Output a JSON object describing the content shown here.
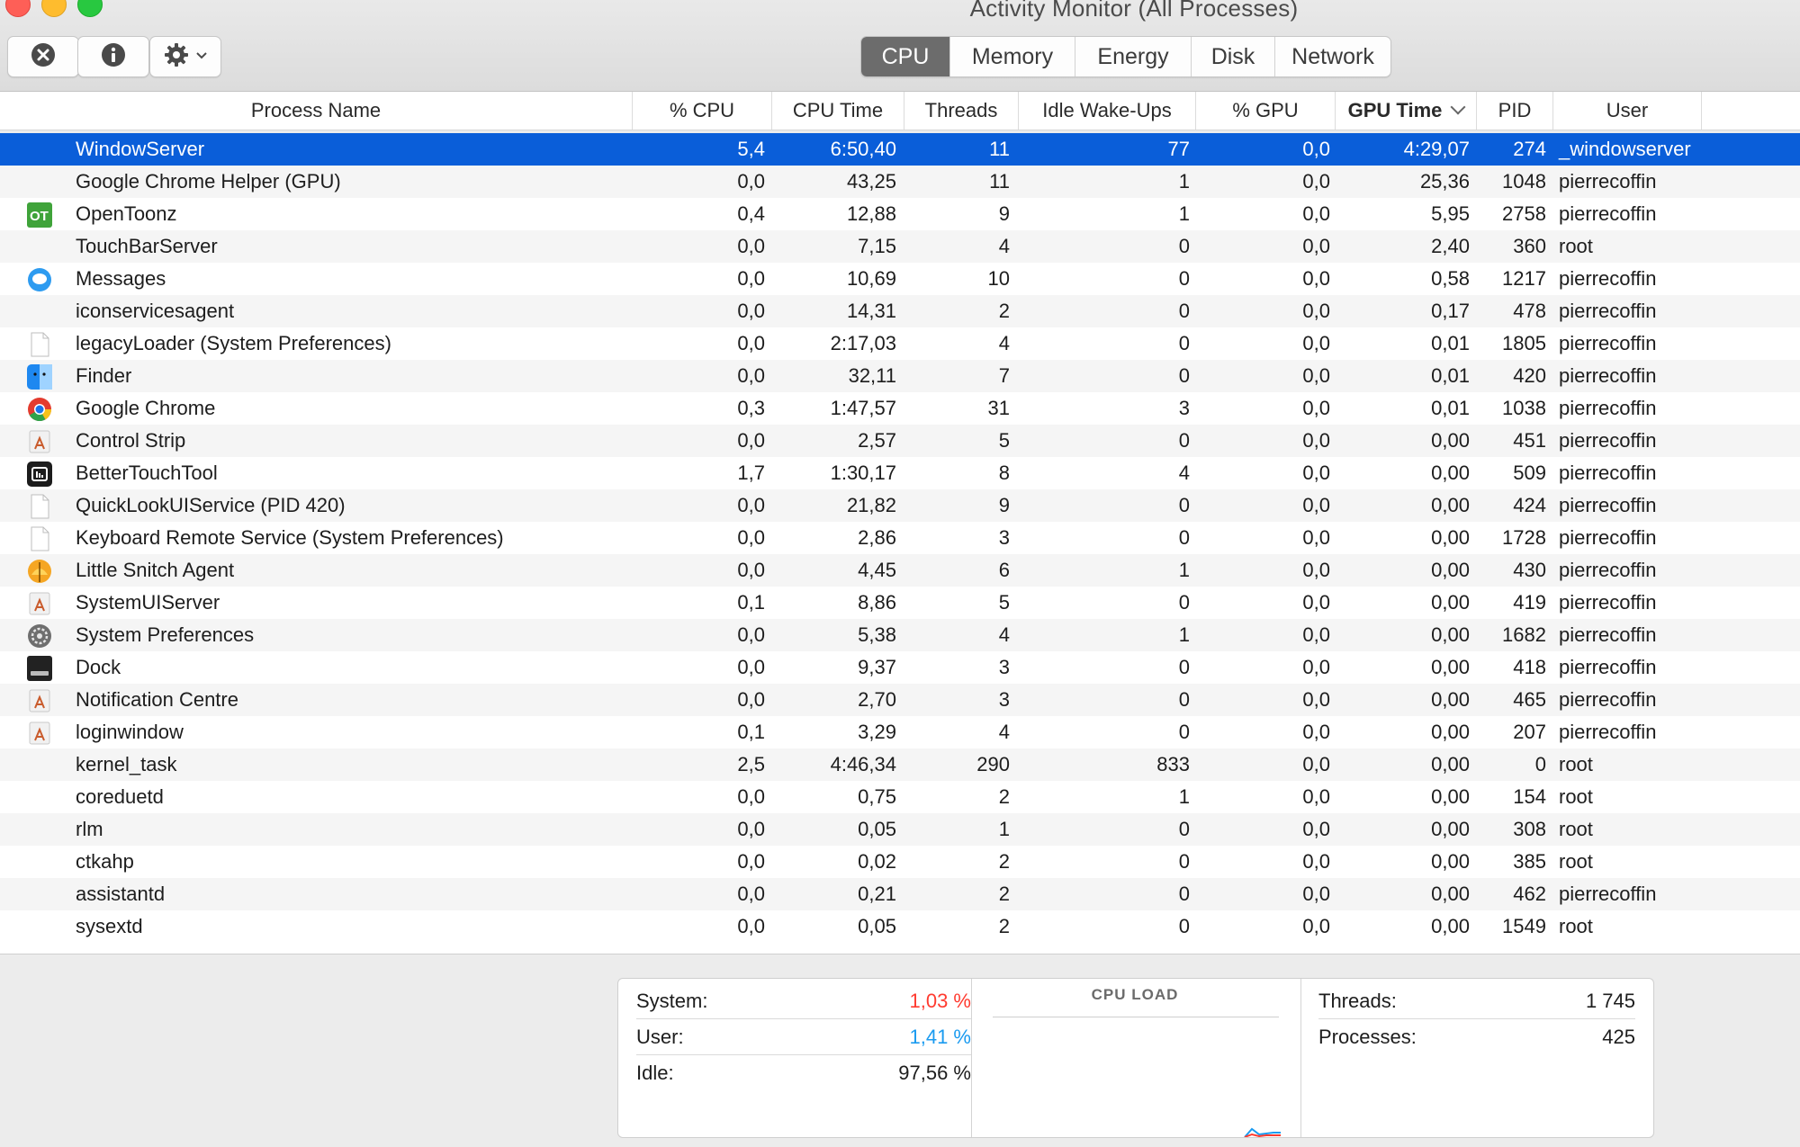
{
  "window": {
    "title": "Activity Monitor (All Processes)"
  },
  "toolbar": {
    "quit_icon": "stop-process-icon",
    "info_icon": "info-icon",
    "gear_icon": "gear-icon",
    "tabs": [
      "CPU",
      "Memory",
      "Energy",
      "Disk",
      "Network"
    ],
    "active_tab": "CPU"
  },
  "columns": {
    "name": "Process Name",
    "cpu": "% CPU",
    "cpu_time": "CPU Time",
    "threads": "Threads",
    "idle_wakeups": "Idle Wake-Ups",
    "gpu": "% GPU",
    "gpu_time": "GPU Time",
    "pid": "PID",
    "user": "User",
    "sorted_by": "GPU Time"
  },
  "processes": [
    {
      "name": "WindowServer",
      "cpu": "5,4",
      "time": "6:50,40",
      "threads": "11",
      "idle": "77",
      "gpu": "0,0",
      "gpu_time": "4:29,07",
      "pid": "274",
      "user": "_windowserver",
      "icon": "none",
      "selected": true
    },
    {
      "name": "Google Chrome Helper (GPU)",
      "cpu": "0,0",
      "time": "43,25",
      "threads": "11",
      "idle": "1",
      "gpu": "0,0",
      "gpu_time": "25,36",
      "pid": "1048",
      "user": "pierrecoffin",
      "icon": "none"
    },
    {
      "name": "OpenToonz",
      "cpu": "0,4",
      "time": "12,88",
      "threads": "9",
      "idle": "1",
      "gpu": "0,0",
      "gpu_time": "5,95",
      "pid": "2758",
      "user": "pierrecoffin",
      "icon": "opentoonz"
    },
    {
      "name": "TouchBarServer",
      "cpu": "0,0",
      "time": "7,15",
      "threads": "4",
      "idle": "0",
      "gpu": "0,0",
      "gpu_time": "2,40",
      "pid": "360",
      "user": "root",
      "icon": "none"
    },
    {
      "name": "Messages",
      "cpu": "0,0",
      "time": "10,69",
      "threads": "10",
      "idle": "0",
      "gpu": "0,0",
      "gpu_time": "0,58",
      "pid": "1217",
      "user": "pierrecoffin",
      "icon": "messages"
    },
    {
      "name": "iconservicesagent",
      "cpu": "0,0",
      "time": "14,31",
      "threads": "2",
      "idle": "0",
      "gpu": "0,0",
      "gpu_time": "0,17",
      "pid": "478",
      "user": "pierrecoffin",
      "icon": "none"
    },
    {
      "name": "legacyLoader (System Preferences)",
      "cpu": "0,0",
      "time": "2:17,03",
      "threads": "4",
      "idle": "0",
      "gpu": "0,0",
      "gpu_time": "0,01",
      "pid": "1805",
      "user": "pierrecoffin",
      "icon": "document"
    },
    {
      "name": "Finder",
      "cpu": "0,0",
      "time": "32,11",
      "threads": "7",
      "idle": "0",
      "gpu": "0,0",
      "gpu_time": "0,01",
      "pid": "420",
      "user": "pierrecoffin",
      "icon": "finder"
    },
    {
      "name": "Google Chrome",
      "cpu": "0,3",
      "time": "1:47,57",
      "threads": "31",
      "idle": "3",
      "gpu": "0,0",
      "gpu_time": "0,01",
      "pid": "1038",
      "user": "pierrecoffin",
      "icon": "chrome"
    },
    {
      "name": "Control Strip",
      "cpu": "0,0",
      "time": "2,57",
      "threads": "5",
      "idle": "0",
      "gpu": "0,0",
      "gpu_time": "0,00",
      "pid": "451",
      "user": "pierrecoffin",
      "icon": "app"
    },
    {
      "name": "BetterTouchTool",
      "cpu": "1,7",
      "time": "1:30,17",
      "threads": "8",
      "idle": "4",
      "gpu": "0,0",
      "gpu_time": "0,00",
      "pid": "509",
      "user": "pierrecoffin",
      "icon": "bettertouchtool"
    },
    {
      "name": "QuickLookUIService (PID 420)",
      "cpu": "0,0",
      "time": "21,82",
      "threads": "9",
      "idle": "0",
      "gpu": "0,0",
      "gpu_time": "0,00",
      "pid": "424",
      "user": "pierrecoffin",
      "icon": "document"
    },
    {
      "name": "Keyboard Remote Service (System Preferences)",
      "cpu": "0,0",
      "time": "2,86",
      "threads": "3",
      "idle": "0",
      "gpu": "0,0",
      "gpu_time": "0,00",
      "pid": "1728",
      "user": "pierrecoffin",
      "icon": "document"
    },
    {
      "name": "Little Snitch Agent",
      "cpu": "0,0",
      "time": "4,45",
      "threads": "6",
      "idle": "1",
      "gpu": "0,0",
      "gpu_time": "0,00",
      "pid": "430",
      "user": "pierrecoffin",
      "icon": "littlesnitch"
    },
    {
      "name": "SystemUIServer",
      "cpu": "0,1",
      "time": "8,86",
      "threads": "5",
      "idle": "0",
      "gpu": "0,0",
      "gpu_time": "0,00",
      "pid": "419",
      "user": "pierrecoffin",
      "icon": "app"
    },
    {
      "name": "System Preferences",
      "cpu": "0,0",
      "time": "5,38",
      "threads": "4",
      "idle": "1",
      "gpu": "0,0",
      "gpu_time": "0,00",
      "pid": "1682",
      "user": "pierrecoffin",
      "icon": "sysprefs"
    },
    {
      "name": "Dock",
      "cpu": "0,0",
      "time": "9,37",
      "threads": "3",
      "idle": "0",
      "gpu": "0,0",
      "gpu_time": "0,00",
      "pid": "418",
      "user": "pierrecoffin",
      "icon": "dock"
    },
    {
      "name": "Notification Centre",
      "cpu": "0,0",
      "time": "2,70",
      "threads": "3",
      "idle": "0",
      "gpu": "0,0",
      "gpu_time": "0,00",
      "pid": "465",
      "user": "pierrecoffin",
      "icon": "app"
    },
    {
      "name": "loginwindow",
      "cpu": "0,1",
      "time": "3,29",
      "threads": "4",
      "idle": "0",
      "gpu": "0,0",
      "gpu_time": "0,00",
      "pid": "207",
      "user": "pierrecoffin",
      "icon": "app"
    },
    {
      "name": "kernel_task",
      "cpu": "2,5",
      "time": "4:46,34",
      "threads": "290",
      "idle": "833",
      "gpu": "0,0",
      "gpu_time": "0,00",
      "pid": "0",
      "user": "root",
      "icon": "none"
    },
    {
      "name": "coreduetd",
      "cpu": "0,0",
      "time": "0,75",
      "threads": "2",
      "idle": "1",
      "gpu": "0,0",
      "gpu_time": "0,00",
      "pid": "154",
      "user": "root",
      "icon": "none"
    },
    {
      "name": "rlm",
      "cpu": "0,0",
      "time": "0,05",
      "threads": "1",
      "idle": "0",
      "gpu": "0,0",
      "gpu_time": "0,00",
      "pid": "308",
      "user": "root",
      "icon": "none"
    },
    {
      "name": "ctkahp",
      "cpu": "0,0",
      "time": "0,02",
      "threads": "2",
      "idle": "0",
      "gpu": "0,0",
      "gpu_time": "0,00",
      "pid": "385",
      "user": "root",
      "icon": "none"
    },
    {
      "name": "assistantd",
      "cpu": "0,0",
      "time": "0,21",
      "threads": "2",
      "idle": "0",
      "gpu": "0,0",
      "gpu_time": "0,00",
      "pid": "462",
      "user": "pierrecoffin",
      "icon": "none"
    },
    {
      "name": "sysextd",
      "cpu": "0,0",
      "time": "0,05",
      "threads": "2",
      "idle": "0",
      "gpu": "0,0",
      "gpu_time": "0,00",
      "pid": "1549",
      "user": "root",
      "icon": "none"
    }
  ],
  "summary": {
    "system_label": "System:",
    "system_value": "1,03 %",
    "user_label": "User:",
    "user_value": "1,41 %",
    "idle_label": "Idle:",
    "idle_value": "97,56 %",
    "cpu_load_title": "CPU LOAD",
    "threads_label": "Threads:",
    "threads_value": "1 745",
    "processes_label": "Processes:",
    "processes_value": "425"
  },
  "colors": {
    "selection": "#0a5ed9",
    "system_red": "#ff3b30",
    "user_blue": "#1a9bf0",
    "active_tab": "#6c6c6c"
  }
}
